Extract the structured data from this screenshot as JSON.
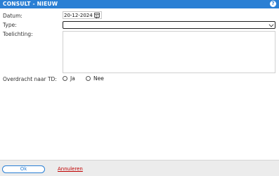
{
  "window": {
    "title": "CONSULT - NIEUW",
    "help_icon": "question-circle-icon",
    "help_glyph": "?"
  },
  "form": {
    "datum_label": "Datum:",
    "datum_value": "20-12-2024",
    "type_label": "Type:",
    "type_value": "",
    "toelichting_label": "Toelichting:",
    "toelichting_value": "",
    "overdracht_label": "Overdracht naar TD:",
    "overdracht_options": [
      "Ja",
      "Nee"
    ],
    "overdracht_selected": null
  },
  "footer": {
    "ok_label": "Ok",
    "cancel_label": "Annuleren"
  },
  "colors": {
    "titlebar": "#2a7fd4",
    "cancel": "#c00000"
  }
}
